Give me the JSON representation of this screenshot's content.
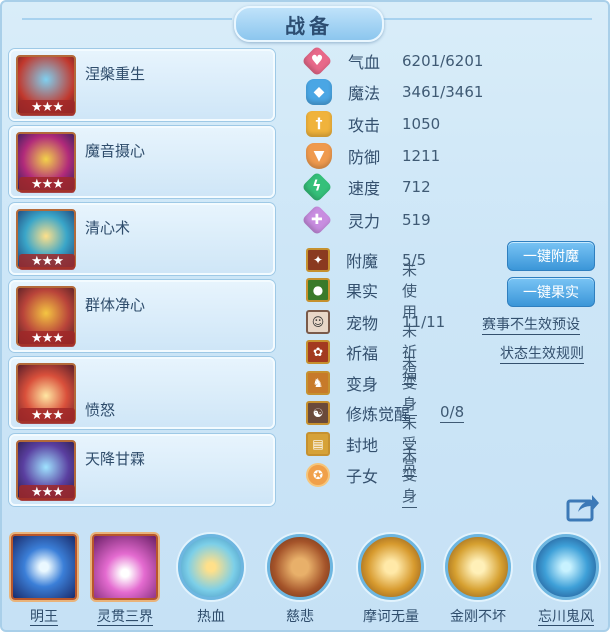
{
  "title": "战备",
  "skills": [
    {
      "name": "涅槃重生",
      "stars": "★★★"
    },
    {
      "name": "魔音摄心",
      "stars": "★★★"
    },
    {
      "name": "清心术",
      "stars": "★★★"
    },
    {
      "name": "群体净心",
      "stars": "★★★"
    },
    {
      "name": "愤怒",
      "stars": "★★★"
    },
    {
      "name": "天降甘霖",
      "stars": "★★★"
    }
  ],
  "stats": [
    {
      "label": "气血",
      "value": "6201/6201",
      "icon": "heart-icon",
      "color": "#e8698a"
    },
    {
      "label": "魔法",
      "value": "3461/3461",
      "icon": "magic-icon",
      "color": "#4aa6e4"
    },
    {
      "label": "攻击",
      "value": "1050",
      "icon": "sword-icon",
      "color": "#f0b33c"
    },
    {
      "label": "防御",
      "value": "1211",
      "icon": "shield-icon",
      "color": "#ef9a4e"
    },
    {
      "label": "速度",
      "value": "712",
      "icon": "speed-icon",
      "color": "#35c07a"
    },
    {
      "label": "灵力",
      "value": "519",
      "icon": "spirit-icon",
      "color": "#c88de0"
    }
  ],
  "attrs": [
    {
      "label": "附魔",
      "value": "5/5",
      "icon": "enchant-icon"
    },
    {
      "label": "果实",
      "value": "未使用",
      "icon": "fruit-icon"
    },
    {
      "label": "宠物",
      "value": "11/11",
      "icon": "pet-icon"
    },
    {
      "label": "祈福",
      "value": "未祈福",
      "icon": "blessing-icon"
    },
    {
      "label": "变身",
      "value": "未变身",
      "icon": "transform-icon"
    },
    {
      "label": "修炼觉醒",
      "value": "0/8",
      "icon": "cultivation-icon"
    },
    {
      "label": "封地",
      "value": "未受赏",
      "icon": "fief-icon"
    },
    {
      "label": "子女",
      "value": "未变身",
      "icon": "children-icon"
    }
  ],
  "buttons": {
    "enchant": "一键附魔",
    "fruit": "一键果实"
  },
  "links": {
    "preset": "赛事不生效预设",
    "rules": "状态生效规则"
  },
  "bottom": [
    {
      "label": "明王"
    },
    {
      "label": "灵贯三界"
    },
    {
      "label": "热血"
    },
    {
      "label": "慈悲"
    },
    {
      "label": "摩诃无量"
    },
    {
      "label": "金刚不坏"
    },
    {
      "label": "忘川鬼风"
    }
  ],
  "colors": {
    "accent": "#3b96d8",
    "text": "#34506e",
    "positive": "#2f9a2f"
  }
}
